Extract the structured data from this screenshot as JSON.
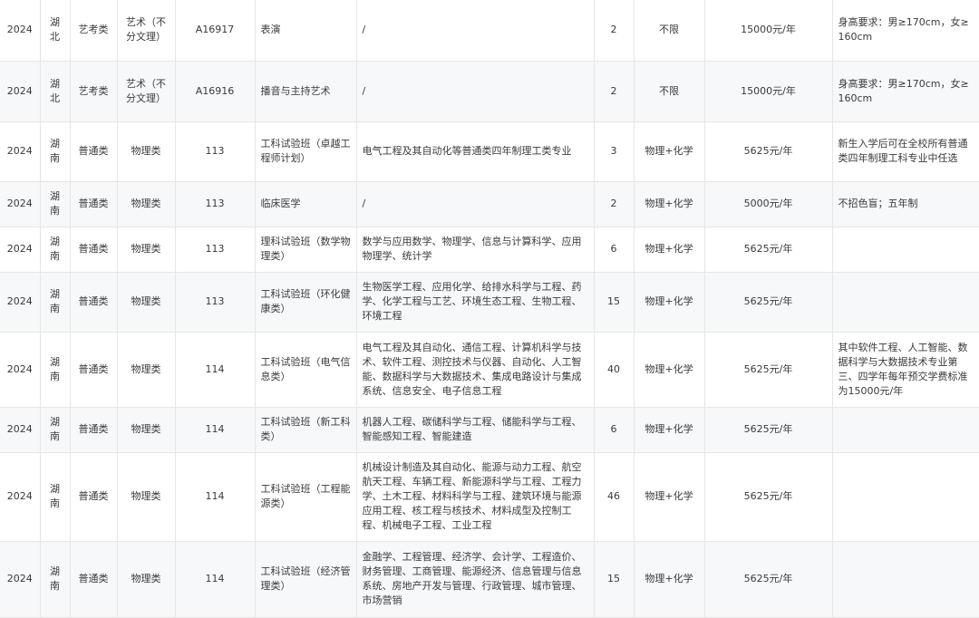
{
  "rows": [
    {
      "year": "2024",
      "province": "湖北",
      "batch": "艺考类",
      "category": "艺术（不分文理）",
      "code": "A16917",
      "major": "表演",
      "includes": "/",
      "plan": "2",
      "subject": "不限",
      "tuition": "15000元/年",
      "note": "身高要求：男≥170cm，女≥160cm"
    },
    {
      "year": "2024",
      "province": "湖北",
      "batch": "艺考类",
      "category": "艺术（不分文理）",
      "code": "A16916",
      "major": "播音与主持艺术",
      "includes": "/",
      "plan": "2",
      "subject": "不限",
      "tuition": "15000元/年",
      "note": "身高要求：男≥170cm，女≥160cm"
    },
    {
      "year": "2024",
      "province": "湖南",
      "batch": "普通类",
      "category": "物理类",
      "code": "113",
      "major": "工科试验班（卓越工程师计划）",
      "includes": "电气工程及其自动化等普通类四年制理工类专业",
      "plan": "3",
      "subject": "物理+化学",
      "tuition": "5625元/年",
      "note": "新生入学后可在全校所有普通类四年制理工科专业中任选"
    },
    {
      "year": "2024",
      "province": "湖南",
      "batch": "普通类",
      "category": "物理类",
      "code": "113",
      "major": "临床医学",
      "includes": "/",
      "plan": "2",
      "subject": "物理+化学",
      "tuition": "5000元/年",
      "note": "不招色盲；五年制"
    },
    {
      "year": "2024",
      "province": "湖南",
      "batch": "普通类",
      "category": "物理类",
      "code": "113",
      "major": "理科试验班（数学物理类）",
      "includes": "数学与应用数学、物理学、信息与计算科学、应用物理学、统计学",
      "plan": "6",
      "subject": "物理+化学",
      "tuition": "5625元/年",
      "note": ""
    },
    {
      "year": "2024",
      "province": "湖南",
      "batch": "普通类",
      "category": "物理类",
      "code": "113",
      "major": "工科试验班（环化健康类）",
      "includes": "生物医学工程、应用化学、给排水科学与工程、药学、化学工程与工艺、环境生态工程、生物工程、环境工程",
      "plan": "15",
      "subject": "物理+化学",
      "tuition": "5625元/年",
      "note": ""
    },
    {
      "year": "2024",
      "province": "湖南",
      "batch": "普通类",
      "category": "物理类",
      "code": "114",
      "major": "工科试验班（电气信息类）",
      "includes": "电气工程及其自动化、通信工程、计算机科学与技术、软件工程、测控技术与仪器、自动化、人工智能、数据科学与大数据技术、集成电路设计与集成系统、信息安全、电子信息工程",
      "plan": "40",
      "subject": "物理+化学",
      "tuition": "5625元/年",
      "note": "其中软件工程、人工智能、数据科学与大数据技术专业第三、四学年每年预交学费标准为15000元/年"
    },
    {
      "year": "2024",
      "province": "湖南",
      "batch": "普通类",
      "category": "物理类",
      "code": "114",
      "major": "工科试验班（新工科类）",
      "includes": "机器人工程、碳储科学与工程、储能科学与工程、智能感知工程、智能建造",
      "plan": "6",
      "subject": "物理+化学",
      "tuition": "5625元/年",
      "note": ""
    },
    {
      "year": "2024",
      "province": "湖南",
      "batch": "普通类",
      "category": "物理类",
      "code": "114",
      "major": "工科试验班（工程能源类）",
      "includes": "机械设计制造及其自动化、能源与动力工程、航空航天工程、车辆工程、新能源科学与工程、工程力学、土木工程、材料科学与工程、建筑环境与能源应用工程、核工程与核技术、材料成型及控制工程、机械电子工程、工业工程",
      "plan": "46",
      "subject": "物理+化学",
      "tuition": "5625元/年",
      "note": ""
    },
    {
      "year": "2024",
      "province": "湖南",
      "batch": "普通类",
      "category": "物理类",
      "code": "114",
      "major": "工科试验班（经济管理类）",
      "includes": "金融学、工程管理、经济学、会计学、工程造价、财务管理、工商管理、能源经济、信息管理与信息系统、房地产开发与管理、行政管理、城市管理、市场营销",
      "plan": "15",
      "subject": "物理+化学",
      "tuition": "5625元/年",
      "note": ""
    }
  ]
}
